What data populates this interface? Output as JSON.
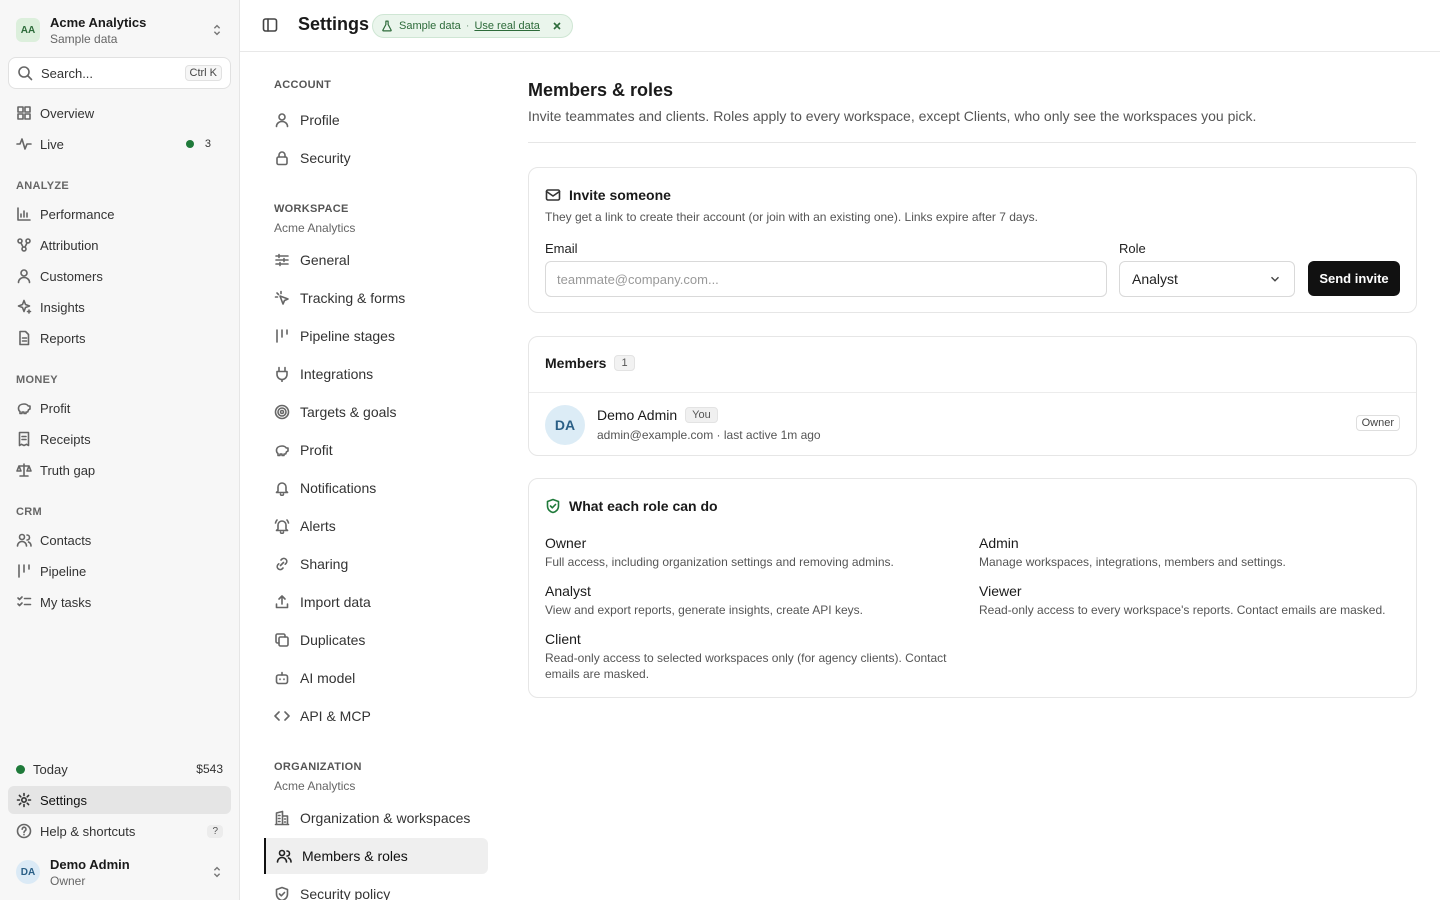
{
  "sidebar": {
    "org": {
      "initials": "AA",
      "name": "Acme Analytics",
      "sub": "Sample data"
    },
    "search": {
      "placeholder": "Search...",
      "shortcut": "Ctrl K"
    },
    "top": [
      {
        "label": "Overview"
      },
      {
        "label": "Live",
        "count": "3"
      }
    ],
    "sections": {
      "analyze": "ANALYZE",
      "money": "MONEY",
      "crm": "CRM"
    },
    "analyze": [
      {
        "label": "Performance"
      },
      {
        "label": "Attribution"
      },
      {
        "label": "Customers"
      },
      {
        "label": "Insights"
      },
      {
        "label": "Reports"
      }
    ],
    "money": [
      {
        "label": "Profit"
      },
      {
        "label": "Receipts"
      },
      {
        "label": "Truth gap"
      }
    ],
    "crm": [
      {
        "label": "Contacts"
      },
      {
        "label": "Pipeline"
      },
      {
        "label": "My tasks"
      }
    ],
    "today": {
      "label": "Today",
      "value": "$543"
    },
    "settings": "Settings",
    "help": {
      "label": "Help & shortcuts",
      "key": "?"
    },
    "user": {
      "initials": "DA",
      "name": "Demo Admin",
      "role": "Owner"
    }
  },
  "header": {
    "title": "Settings",
    "pill": {
      "text": "Sample data",
      "sep": "·",
      "link": "Use real data"
    }
  },
  "settings_nav": {
    "account": {
      "title": "ACCOUNT",
      "items": [
        {
          "label": "Profile"
        },
        {
          "label": "Security"
        }
      ]
    },
    "workspace": {
      "title": "WORKSPACE",
      "sub": "Acme Analytics",
      "items": [
        {
          "label": "General"
        },
        {
          "label": "Tracking & forms"
        },
        {
          "label": "Pipeline stages"
        },
        {
          "label": "Integrations"
        },
        {
          "label": "Targets & goals"
        },
        {
          "label": "Profit"
        },
        {
          "label": "Notifications"
        },
        {
          "label": "Alerts"
        },
        {
          "label": "Sharing"
        },
        {
          "label": "Import data"
        },
        {
          "label": "Duplicates"
        },
        {
          "label": "AI model"
        },
        {
          "label": "API & MCP"
        }
      ]
    },
    "organization": {
      "title": "ORGANIZATION",
      "sub": "Acme Analytics",
      "items": [
        {
          "label": "Organization & workspaces"
        },
        {
          "label": "Members & roles"
        },
        {
          "label": "Security policy"
        }
      ]
    }
  },
  "main": {
    "title": "Members & roles",
    "description": "Invite teammates and clients. Roles apply to every workspace, except Clients, who only see the workspaces you pick.",
    "invite": {
      "title": "Invite someone",
      "description": "They get a link to create their account (or join with an existing one). Links expire after 7 days.",
      "email_label": "Email",
      "email_placeholder": "teammate@company.com...",
      "role_label": "Role",
      "role_value": "Analyst",
      "button": "Send invite"
    },
    "members": {
      "title": "Members",
      "count": "1",
      "rows": [
        {
          "initials": "DA",
          "name": "Demo Admin",
          "you": "You",
          "detail": "admin@example.com · last active 1m ago",
          "role": "Owner"
        }
      ]
    },
    "roles": {
      "title": "What each role can do",
      "items": [
        {
          "name": "Owner",
          "desc": "Full access, including organization settings and removing admins."
        },
        {
          "name": "Admin",
          "desc": "Manage workspaces, integrations, members and settings."
        },
        {
          "name": "Analyst",
          "desc": "View and export reports, generate insights, create API keys."
        },
        {
          "name": "Viewer",
          "desc": "Read-only access to every workspace's reports. Contact emails are masked."
        },
        {
          "name": "Client",
          "desc": "Read-only access to selected workspaces only (for agency clients). Contact emails are masked."
        }
      ]
    }
  }
}
